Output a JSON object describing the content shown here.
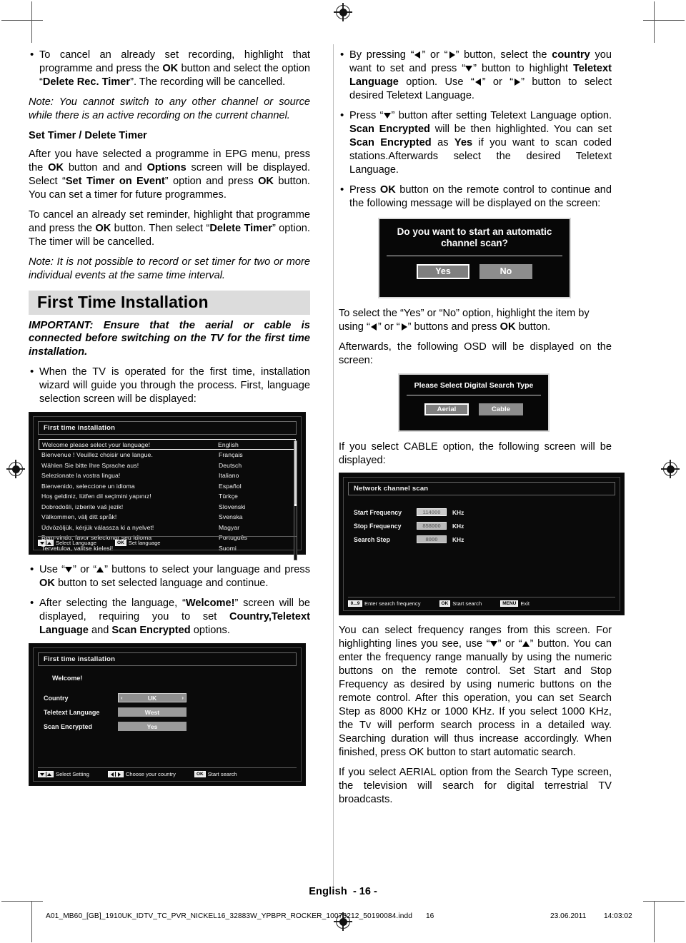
{
  "page": {
    "footer_language": "English",
    "footer_page": "- 16 -",
    "imprint_file": "A01_MB60_[GB]_1910UK_IDTV_TC_PVR_NICKEL16_32883W_YPBPR_ROCKER_10073212_50190084.indd",
    "imprint_number": "16",
    "imprint_date": "23.06.2011",
    "imprint_time": "14:03:02"
  },
  "left_column": {
    "para_cancel_recording_1": "To cancel an already set recording, highlight that programme and press the ",
    "para_cancel_recording_ok": "OK",
    "para_cancel_recording_2": " button and select the option “",
    "para_cancel_recording_delete": "Delete Rec. Timer",
    "para_cancel_recording_3": "”. The recording will be cancelled.",
    "note_switch_channel": "Note: You cannot switch to any other channel or source while there is an active recording on the current channel.",
    "heading_set_delete_timer": "Set Timer / Delete Timer",
    "para_set_timer_1": "After you have selected a programme in EPG menu, press the ",
    "para_set_timer_ok1": "OK",
    "para_set_timer_2": " button and and ",
    "para_set_timer_options": "Options",
    "para_set_timer_3": " screen will be displayed. Select “",
    "para_set_timer_event": "Set Timer on Event",
    "para_set_timer_4": "” option and press ",
    "para_set_timer_ok2": "OK",
    "para_set_timer_5": " button. You can set a timer for future programmes.",
    "para_cancel_reminder_1": "To cancel an already set reminder, highlight that programme and press the ",
    "para_cancel_reminder_ok": "OK",
    "para_cancel_reminder_2": " button. Then select “",
    "para_cancel_reminder_delete": "Delete Timer",
    "para_cancel_reminder_3": "” option. The timer will be cancelled.",
    "note_two_events": "Note: It is not possible to record or set timer for two or more individual events at the same time interval.",
    "section_title": "First Time Installation",
    "important_notice": "IMPORTANT: Ensure that the aerial or cable is connected before switching on the TV for the first time installation.",
    "para_first_time": "When the TV is operated for the first time, installation wizard will guide you through the process. First, language selection screen will be displayed:",
    "para_use_buttons_1": "Use “",
    "para_use_buttons_2": "” or “",
    "para_use_buttons_3": "” buttons to select your language and press ",
    "para_use_buttons_ok": "OK",
    "para_use_buttons_4": " button to set selected language and continue.",
    "para_welcome_1": "After selecting the language, “",
    "para_welcome_bold": "Welcome!",
    "para_welcome_2": "” screen will be displayed, requiring you to set ",
    "para_welcome_country": "Country,Teletext Language",
    "para_welcome_3": " and ",
    "para_welcome_scan": "Scan Encrypted",
    "para_welcome_4": " options."
  },
  "right_column": {
    "para_country_1": "By pressing “",
    "para_country_2": "” or “",
    "para_country_3": "” button, select the ",
    "para_country_bold": "country",
    "para_country_4": " you want to set and press “",
    "para_country_5": "” button to highlight ",
    "para_country_teletext": "Teletext Language",
    "para_country_6": " option. Use “",
    "para_country_7": "” or “",
    "para_country_8": "” button to select desired Teletext Language.",
    "para_scanenc_1": "Press “",
    "para_scanenc_2": "” button after setting Teletext Language option. ",
    "para_scanenc_bold1": "Scan Encrypted",
    "para_scanenc_3": " will be then highlighted. You can set ",
    "para_scanenc_bold2": "Scan Encrypted",
    "para_scanenc_4": " as ",
    "para_scanenc_bold3": "Yes",
    "para_scanenc_5": " if you want to scan coded stations.Afterwards select the desired Teletext Language.",
    "para_pressok_1": "Press ",
    "para_pressok_ok": "OK",
    "para_pressok_2": " button on the remote control to continue and the following message will be displayed on the screen:",
    "para_selectyesno_1": "To select the “Yes” or “No” option, highlight the item by using “",
    "para_selectyesno_2": "” or “",
    "para_selectyesno_3": "” buttons and press ",
    "para_selectyesno_ok": "OK",
    "para_selectyesno_4": " button.",
    "para_afterwards_osd": "Afterwards, the following OSD will be displayed on the screen:",
    "para_cable_option": "If you select CABLE option, the following screen will be displayed:",
    "para_freq_ranges": "You can select frequency ranges from this screen. For highlighting lines you see, use “",
    "para_freq_ranges_2": "” or “",
    "para_freq_ranges_3": "” button. You can enter the frequency range manually by using the numeric buttons on the remote control. Set Start and Stop Frequency as desired by using numeric buttons on the remote control. After this operation, you can set Search Step as 8000 KHz or 1000 KHz. If you select 1000 KHz, the Tv will perform search process in a detailed way. Searching duration will thus increase accordingly. When finished, press OK button to start automatic search.",
    "para_aerial_option": "If you select AERIAL option from the Search Type screen, the television will search for digital terrestrial TV broadcasts."
  },
  "osd_language": {
    "title": "First time installation",
    "rows": [
      {
        "prompt": "Welcome please select your language!",
        "name": "English",
        "selected": true
      },
      {
        "prompt": "Bienvenue ! Veuillez choisir une langue.",
        "name": "Français",
        "selected": false
      },
      {
        "prompt": "Wählen Sie bitte Ihre Sprache aus!",
        "name": "Deutsch",
        "selected": false
      },
      {
        "prompt": "Selezionate la vostra lingua!",
        "name": "Italiano",
        "selected": false
      },
      {
        "prompt": "Bienvenido, seleccione un idioma",
        "name": "Español",
        "selected": false
      },
      {
        "prompt": "Hoş geldiniz, lütfen dil seçimini yapınız!",
        "name": "Türkçe",
        "selected": false
      },
      {
        "prompt": "Dobrodošli, izberite vaš jezik!",
        "name": "Slovenski",
        "selected": false
      },
      {
        "prompt": "Välkommen, välj ditt språk!",
        "name": "Svenska",
        "selected": false
      },
      {
        "prompt": "Üdvözöljük, kérjük válassza ki a nyelvet!",
        "name": "Magyar",
        "selected": false
      },
      {
        "prompt": "Bem-vindo, favor selecionar seu idioma",
        "name": "Português",
        "selected": false
      },
      {
        "prompt": "Tervetuloa, valitse kielesi!",
        "name": "Suomi",
        "selected": false
      }
    ],
    "foot_select": "Select Language",
    "foot_set": "Set language",
    "foot_set_key": "OK"
  },
  "osd_welcome": {
    "title": "First time installation",
    "welcome_label": "Welcome!",
    "rows": [
      {
        "label": "Country",
        "value": "UK",
        "active": true
      },
      {
        "label": "Teletext Language",
        "value": "West",
        "active": false
      },
      {
        "label": "Scan Encrypted",
        "value": "Yes",
        "active": false
      }
    ],
    "foot_select": "Select Setting",
    "foot_choose": "Choose your country",
    "foot_start": "Start search",
    "foot_start_key": "OK"
  },
  "osd_scan_dialog": {
    "message": "Do you want to start an automatic channel scan?",
    "buttons": [
      {
        "label": "Yes",
        "selected": true
      },
      {
        "label": "No",
        "selected": false
      }
    ]
  },
  "osd_search_type": {
    "message": "Please Select Digital Search Type",
    "buttons": [
      {
        "label": "Aerial",
        "selected": true
      },
      {
        "label": "Cable",
        "selected": false
      }
    ]
  },
  "osd_network_scan": {
    "title": "Network channel scan",
    "rows": [
      {
        "label": "Start Frequency",
        "value": "114000",
        "unit": "KHz",
        "highlight": true
      },
      {
        "label": "Stop Frequency",
        "value": "858000",
        "unit": "KHz",
        "highlight": false
      },
      {
        "label": "Search Step",
        "value": "8000",
        "unit": "KHz",
        "highlight": false
      }
    ],
    "foot_enter_key": "0...9",
    "foot_enter": "Enter search frequency",
    "foot_start_key": "OK",
    "foot_start": "Start search",
    "foot_exit_key": "MENU",
    "foot_exit": "Exit"
  }
}
